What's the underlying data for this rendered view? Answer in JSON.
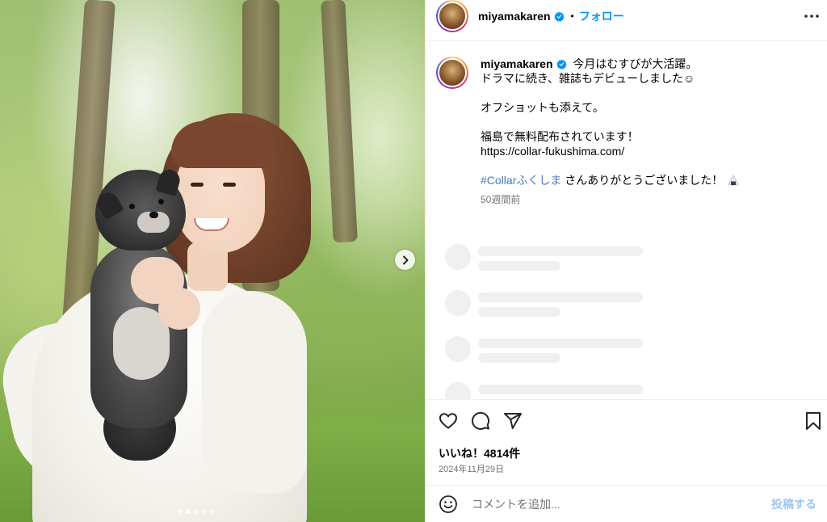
{
  "post": {
    "username": "miyamakaren",
    "header_separator": "•",
    "follow_label": "フォロー",
    "photo_alt": "Woman holding a black Pomeranian outdoors"
  },
  "caption": {
    "username": "miyamakaren",
    "lines": [
      "今月はむすびが大活躍。",
      "ドラマに続き、雑誌もデビューしました☺",
      "オフショットも添えて。",
      "福島で無料配布されています！",
      "https://collar-fukushima.com/"
    ],
    "hashtag": "#Collarふくしま",
    "hashtag_suffix": " さんありがとうございました！",
    "time": "50週間前"
  },
  "engagement": {
    "likes_label": "いいね！4814件",
    "date": "2024年11月29日"
  },
  "comment": {
    "placeholder": "コメントを追加...",
    "post_label": "投稿する"
  },
  "colors": {
    "link_blue": "#0095f6",
    "hashtag": "#4a78c4",
    "muted": "#737373",
    "post_disabled": "#9cc9f4"
  },
  "carousel": {
    "current": 2,
    "total": 5
  }
}
